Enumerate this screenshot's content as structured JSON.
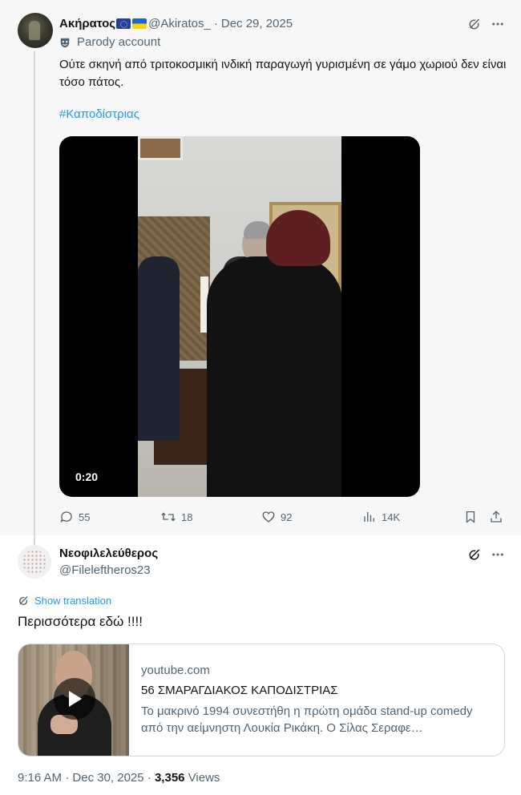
{
  "tweet1": {
    "author_name": "Ακήρατος",
    "handle": "@Akiratos_",
    "date": "Dec 29, 2025",
    "badge_label": "Parody account",
    "text": "Ούτε σκηνή από τριτοκοσμική ινδική παραγωγή γυρισμένη σε γάμο χωριού δεν είναι τόσο πάτος.",
    "hashtag": "#Καποδίστριας",
    "video_duration": "0:20",
    "replies": "55",
    "reposts": "18",
    "likes": "92",
    "views": "14K"
  },
  "tweet2": {
    "author_name": "Νεοφιλελεύθερος",
    "handle": "@Fileleftheros23",
    "show_translation": "Show translation",
    "text": "Περισσότερα εδώ !!!!",
    "card": {
      "domain": "youtube.com",
      "title": "56 ΣΜΑΡΑΓΔΙΑΚΟΣ ΚΑΠΟΔΙΣΤΡΙΑΣ",
      "description": "Το μακρινό 1994 συνεστήθη η πρώτη ομάδα stand-up comedy από την αείμνηστη Λουκία Ρικάκη. Ο Σίλας Σεραφε…"
    },
    "time": "9:16 AM",
    "date": "Dec 30, 2025",
    "views_count": "3,356",
    "views_label": "Views"
  },
  "icons": {
    "grok": "grok-icon",
    "more": "more-icon",
    "mask": "parody-mask-icon",
    "reply": "reply-icon",
    "repost": "repost-icon",
    "like": "like-icon",
    "views": "views-icon",
    "bookmark": "bookmark-icon",
    "share": "share-icon",
    "translate": "translate-icon",
    "play": "play-icon"
  },
  "colors": {
    "link": "#1d9bf0",
    "secondary_text": "#536471",
    "primary_text": "#0f1419",
    "thread_background": "#f7f7f7"
  }
}
